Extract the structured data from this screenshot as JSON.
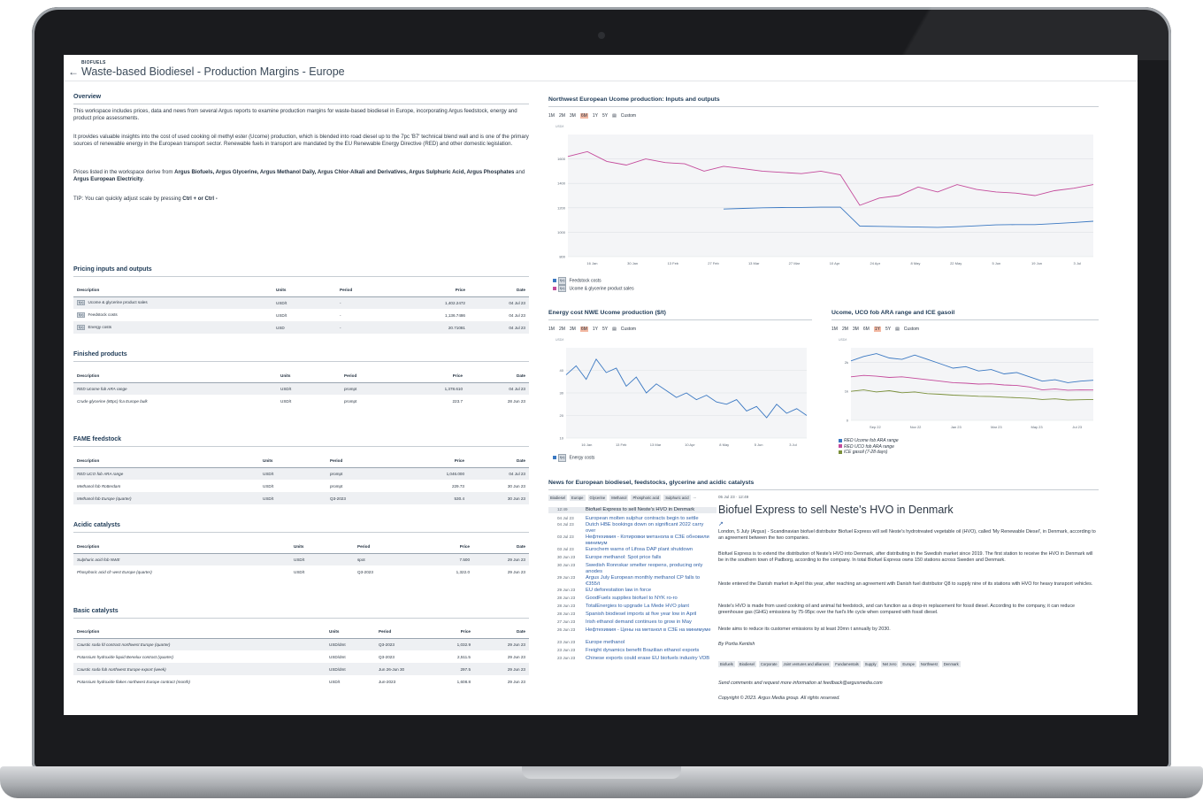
{
  "page": {
    "category": "BIOFUELS",
    "title": "Waste-based Biodiesel - Production Margins - Europe"
  },
  "overview": {
    "heading": "Overview",
    "p1": "This workspace includes prices, data and news from several Argus reports to examine production margins for waste-based biodiesel in Europe, incorporating Argus feedstock, energy and product price assessments.",
    "p2": "It provides valuable insights into the cost of used cooking oil methyl ester (Ucome) production, which is blended into road diesel up to the 7pc 'B7' technical blend wall and is one of the primary sources of renewable energy in the European transport sector. Renewable fuels in transport are mandated by the EU Renewable Energy Directive (RED) and other domestic legislation.",
    "p3_pre": "Prices listed in the workspace derive from ",
    "p3_bold1": "Argus Biofuels, Argus Glycerine, Argus Methanol Daily, Argus Chlor-Alkali and Derivatives, Argus Sulphuric Acid, Argus Phosphates",
    "p3_mid": " and ",
    "p3_bold2": "Argus European Electricity",
    "p3_end": ".",
    "tip_pre": "TIP: You can quickly adjust scale by pressing ",
    "tip_keys": "Ctrl + or Ctrl -"
  },
  "columns": {
    "description": "Description",
    "units": "Units",
    "period": "Period",
    "price": "Price",
    "date": "Date"
  },
  "fx_badge": "f(x)",
  "pricing": {
    "heading": "Pricing inputs and outputs",
    "rows": [
      {
        "desc": "Ucome & glycerine product sales",
        "units": "USD/t",
        "period": "-",
        "price": "1,402.2472",
        "date": "04 Jul 23"
      },
      {
        "desc": "Feedstock costs",
        "units": "USD/t",
        "period": "-",
        "price": "1,136.7486",
        "date": "04 Jul 23"
      },
      {
        "desc": "Energy costs",
        "units": "USD",
        "period": "-",
        "price": "20.71081",
        "date": "04 Jul 23"
      }
    ]
  },
  "finished": {
    "heading": "Finished products",
    "rows": [
      {
        "desc": "RED Ucome fob ARA range",
        "units": "USD/t",
        "period": "prompt",
        "price": "1,378.610",
        "date": "04 Jul 23"
      },
      {
        "desc": "Crude glycerine (80pc) fca Europe bulk",
        "units": "USD/t",
        "period": "prompt",
        "price": "223.7",
        "date": "28 Jun 23"
      }
    ]
  },
  "fame": {
    "heading": "FAME feedstock",
    "rows": [
      {
        "desc": "RED UCO fob ARA range",
        "units": "USD/t",
        "period": "prompt",
        "price": "1,046.000",
        "date": "04 Jul 23"
      },
      {
        "desc": "Methanol fob Rotterdam",
        "units": "USD/t",
        "period": "prompt",
        "price": "229.73",
        "date": "30 Jun 23"
      },
      {
        "desc": "Methanol fob Europe (quarter)",
        "units": "USD/t",
        "period": "Q3-2023",
        "price": "530.4",
        "date": "30 Jun 23"
      }
    ]
  },
  "acidic": {
    "heading": "Acidic catalysts",
    "rows": [
      {
        "desc": "Sulphuric acid fob NWE",
        "units": "USD/t",
        "period": "spot",
        "price": "7.500",
        "date": "29 Jun 23"
      },
      {
        "desc": "Phosphoric acid cfr west Europe (quarter)",
        "units": "USD/t",
        "period": "Q3-2023",
        "price": "1,322.0",
        "date": "29 Jun 23"
      }
    ]
  },
  "basic": {
    "heading": "Basic catalysts",
    "rows": [
      {
        "desc": "Caustic soda fd contract northwest Europe (quarter)",
        "units": "USD/dmt",
        "period": "Q3-2023",
        "price": "1,032.9",
        "date": "29 Jun 23"
      },
      {
        "desc": "Potassium hydroxide liquid Benelux contract (quarter)",
        "units": "USD/dmt",
        "period": "Q3-2023",
        "price": "2,511.5",
        "date": "29 Jun 23"
      },
      {
        "desc": "Caustic soda fob northwest Europe export (week)",
        "units": "USD/dmt",
        "period": "Jun 26-Jun 30",
        "price": "297.5",
        "date": "29 Jun 23"
      },
      {
        "desc": "Potassium hydroxide flakes northwest Europe contract (month)",
        "units": "USD/t",
        "period": "Jun-2023",
        "price": "1,608.8",
        "date": "29 Jun 23"
      }
    ]
  },
  "range_buttons": [
    "1M",
    "2M",
    "3M",
    "6M",
    "1Y",
    "5Y"
  ],
  "range_custom": "Custom",
  "chart_data": [
    {
      "type": "line",
      "title": "Northwest European Ucome production: Inputs and outputs",
      "units": "USD/t",
      "x_ticks": [
        "16 Jan",
        "30 Jan",
        "13 Feb",
        "27 Feb",
        "13 Mar",
        "27 Mar",
        "10 Apr",
        "24 Apr",
        "8 May",
        "22 May",
        "5 Jun",
        "19 Jun",
        "3 Jul"
      ],
      "y_ticks": [
        800,
        1000,
        1200,
        1400,
        1600
      ],
      "ylim": [
        800,
        1800
      ],
      "x_index_range": [
        0,
        27
      ],
      "series": [
        {
          "name": "Feedstock costs",
          "color": "#3a78c2",
          "x": [
            8,
            9,
            10,
            11,
            12,
            13,
            14,
            15,
            16,
            17,
            18,
            19,
            20,
            21,
            22,
            23,
            24,
            25,
            26,
            27
          ],
          "values": [
            1190,
            1195,
            1200,
            1202,
            1203,
            1205,
            1205,
            1050,
            1048,
            1045,
            1042,
            1040,
            1045,
            1052,
            1060,
            1062,
            1062,
            1070,
            1080,
            1090
          ]
        },
        {
          "name": "Ucome & glycerine product sales",
          "color": "#c44a9b",
          "x": [
            0,
            1,
            2,
            3,
            4,
            5,
            6,
            7,
            8,
            9,
            10,
            11,
            12,
            13,
            14,
            15,
            16,
            17,
            18,
            19,
            20,
            21,
            22,
            23,
            24,
            25,
            26,
            27
          ],
          "values": [
            1620,
            1660,
            1580,
            1550,
            1600,
            1570,
            1560,
            1500,
            1540,
            1520,
            1500,
            1490,
            1480,
            1500,
            1470,
            1220,
            1280,
            1300,
            1370,
            1330,
            1390,
            1350,
            1330,
            1320,
            1300,
            1340,
            1360,
            1390
          ]
        }
      ]
    },
    {
      "type": "line",
      "title": "Energy cost NWE Ucome production ($/t)",
      "units": "USD/t",
      "x_ticks": [
        "16 Jan",
        "13 Feb",
        "13 Mar",
        "10 Apr",
        "8 May",
        "5 Jun",
        "3 Jul"
      ],
      "y_ticks": [
        10,
        20,
        30,
        40
      ],
      "ylim": [
        10,
        50
      ],
      "x_index_range": [
        0,
        24
      ],
      "series": [
        {
          "name": "Energy costs",
          "color": "#3a78c2",
          "x": [
            0,
            1,
            2,
            3,
            4,
            5,
            6,
            7,
            8,
            9,
            10,
            11,
            12,
            13,
            14,
            15,
            16,
            17,
            18,
            19,
            20,
            21,
            22,
            23,
            24
          ],
          "values": [
            38,
            42,
            36,
            45,
            39,
            41,
            33,
            37,
            30,
            34,
            31,
            28,
            30,
            27,
            29,
            26,
            25,
            27,
            22,
            24,
            19,
            25,
            21,
            23,
            20
          ]
        }
      ]
    },
    {
      "type": "line",
      "title": "Ucome, UCO fob ARA range and ICE gasoil",
      "units": "USD/t",
      "x_ticks": [
        "Sep 22",
        "Nov 22",
        "Jan 23",
        "Mar 23",
        "May 23",
        "Jul 23"
      ],
      "y_ticks": [
        "0",
        "1k",
        "2k"
      ],
      "ylim": [
        0,
        2500
      ],
      "x_index_range": [
        0,
        19
      ],
      "series": [
        {
          "name": "RED Ucome fob ARA range",
          "color": "#3a78c2",
          "x": [
            0,
            1,
            2,
            3,
            4,
            5,
            6,
            7,
            8,
            9,
            10,
            11,
            12,
            13,
            14,
            15,
            16,
            17,
            18,
            19
          ],
          "values": [
            2050,
            2200,
            2300,
            2150,
            2100,
            2250,
            2100,
            1950,
            1800,
            1850,
            1700,
            1750,
            1600,
            1650,
            1500,
            1350,
            1400,
            1300,
            1350,
            1380
          ]
        },
        {
          "name": "RED UCO fob ARA range",
          "color": "#c44a9b",
          "x": [
            0,
            1,
            2,
            3,
            4,
            5,
            6,
            7,
            8,
            9,
            10,
            11,
            12,
            13,
            14,
            15,
            16,
            17,
            18,
            19
          ],
          "values": [
            1500,
            1550,
            1520,
            1480,
            1500,
            1450,
            1400,
            1350,
            1300,
            1280,
            1250,
            1260,
            1220,
            1200,
            1150,
            1050,
            1080,
            1040,
            1050,
            1046
          ]
        },
        {
          "name": "ICE gasoil (7-28 days)",
          "color": "#7a8f3a",
          "x": [
            0,
            1,
            2,
            3,
            4,
            5,
            6,
            7,
            8,
            9,
            10,
            11,
            12,
            13,
            14,
            15,
            16,
            17,
            18,
            19
          ],
          "values": [
            1000,
            1050,
            980,
            1020,
            950,
            980,
            920,
            900,
            870,
            850,
            830,
            820,
            800,
            780,
            760,
            720,
            740,
            700,
            710,
            720
          ]
        }
      ]
    }
  ],
  "news": {
    "heading": "News for European biodiesel, feedstocks, glycerine and acidic catalysts",
    "filters": [
      "Biodiesel",
      "Europe",
      "Glycerine",
      "Methanol",
      "Phosphoric acid",
      "Sulphuric acid",
      "..."
    ],
    "items": [
      {
        "date": "12:49",
        "title": "Biofuel Express to sell Neste's HVO in Denmark"
      },
      {
        "date": "04 Jul 23",
        "title": "European molten sulphur contracts begin to settle"
      },
      {
        "date": "04 Jul 23",
        "title": "Dutch HBE bookings down on significant 2022 carry over"
      },
      {
        "date": "03 Jul 23",
        "title": "Нефтехимия - Котировки метанола в СЗЕ обновили минимум"
      },
      {
        "date": "03 Jul 23",
        "title": "Eurochem warns of Lifosa DAP plant shutdown"
      },
      {
        "date": "30 Jun 23",
        "title": "Europe methanol: Spot price falls"
      },
      {
        "date": "30 Jun 23",
        "title": "Swedish Ronnskar smelter reopens, producing only anodes"
      },
      {
        "date": "29 Jun 23",
        "title": "Argus July European monthly methanol CP falls to €355/t"
      },
      {
        "date": "29 Jun 23",
        "title": "EU deforestation law in force"
      },
      {
        "date": "28 Jun 23",
        "title": "GoodFuels supplies biofuel to NYK ro-ro"
      },
      {
        "date": "28 Jun 23",
        "title": "TotalEnergies to upgrade La Mede HVO plant"
      },
      {
        "date": "28 Jun 23",
        "title": "Spanish biodiesel imports at five year low in April"
      },
      {
        "date": "27 Jun 23",
        "title": "Irish ethanol demand continues to grow in May"
      },
      {
        "date": "26 Jun 23",
        "title": "Нефтехимия - Цены на метанол в СЗЕ на минимуме"
      },
      {
        "date": "23 Jun 23",
        "title": "Europe methanol"
      },
      {
        "date": "23 Jun 23",
        "title": "Freight dynamics benefit Brazilian ethanol exports"
      },
      {
        "date": "23 Jun 23",
        "title": "Chinese exports could erase EU biofuels industry VDB"
      }
    ]
  },
  "article": {
    "timestamp": "05 Jul 23 · 12:49",
    "title": "Biofuel Express to sell Neste's HVO in Denmark",
    "p1": "London, 5 July (Argus) - Scandinavian biofuel distributor Biofuel Express will sell Neste's hydrotreated vegetable oil (HVO), called 'My Renewable Diesel', in Denmark, according to an agreement between the two companies.",
    "p2": "Biofuel Express is to extend the distribution of Neste's HVO into Denmark, after distributing in the Swedish market since 2019. The first station to receive the HVO in Denmark will be in the southern town of Padborg, according to the company. In total Biofuel Express owns 150 stations across Sweden and Denmark.",
    "p3": "Neste entered the Danish market in April this year, after reaching an agreement with Danish fuel distributor Q8 to supply nine of its stations with HVO for heavy transport vehicles.",
    "p4": "Neste's HVO is made from used cooking oil and animal fat feedstock, and can function as a drop-in replacement for fossil diesel. According to the company, it can reduce greenhouse gas (GHG) emissions by 75-95pc over the fuel's life cycle when compared with fossil diesel.",
    "p5": "Neste aims to reduce its customer emissions by at least 20mn t annually by 2030.",
    "byline": "By Portia Kentish",
    "tags": [
      "Biofuels",
      "Biodiesel",
      "Corporate",
      "Joint ventures and alliances",
      "Fundamentals",
      "Supply",
      "Net zero",
      "Europe",
      "Northwest",
      "Denmark"
    ],
    "contact": "Send comments and request more information at feedback@argusmedia.com",
    "copyright": "Copyright © 2023. Argus Media group. All rights reserved."
  }
}
